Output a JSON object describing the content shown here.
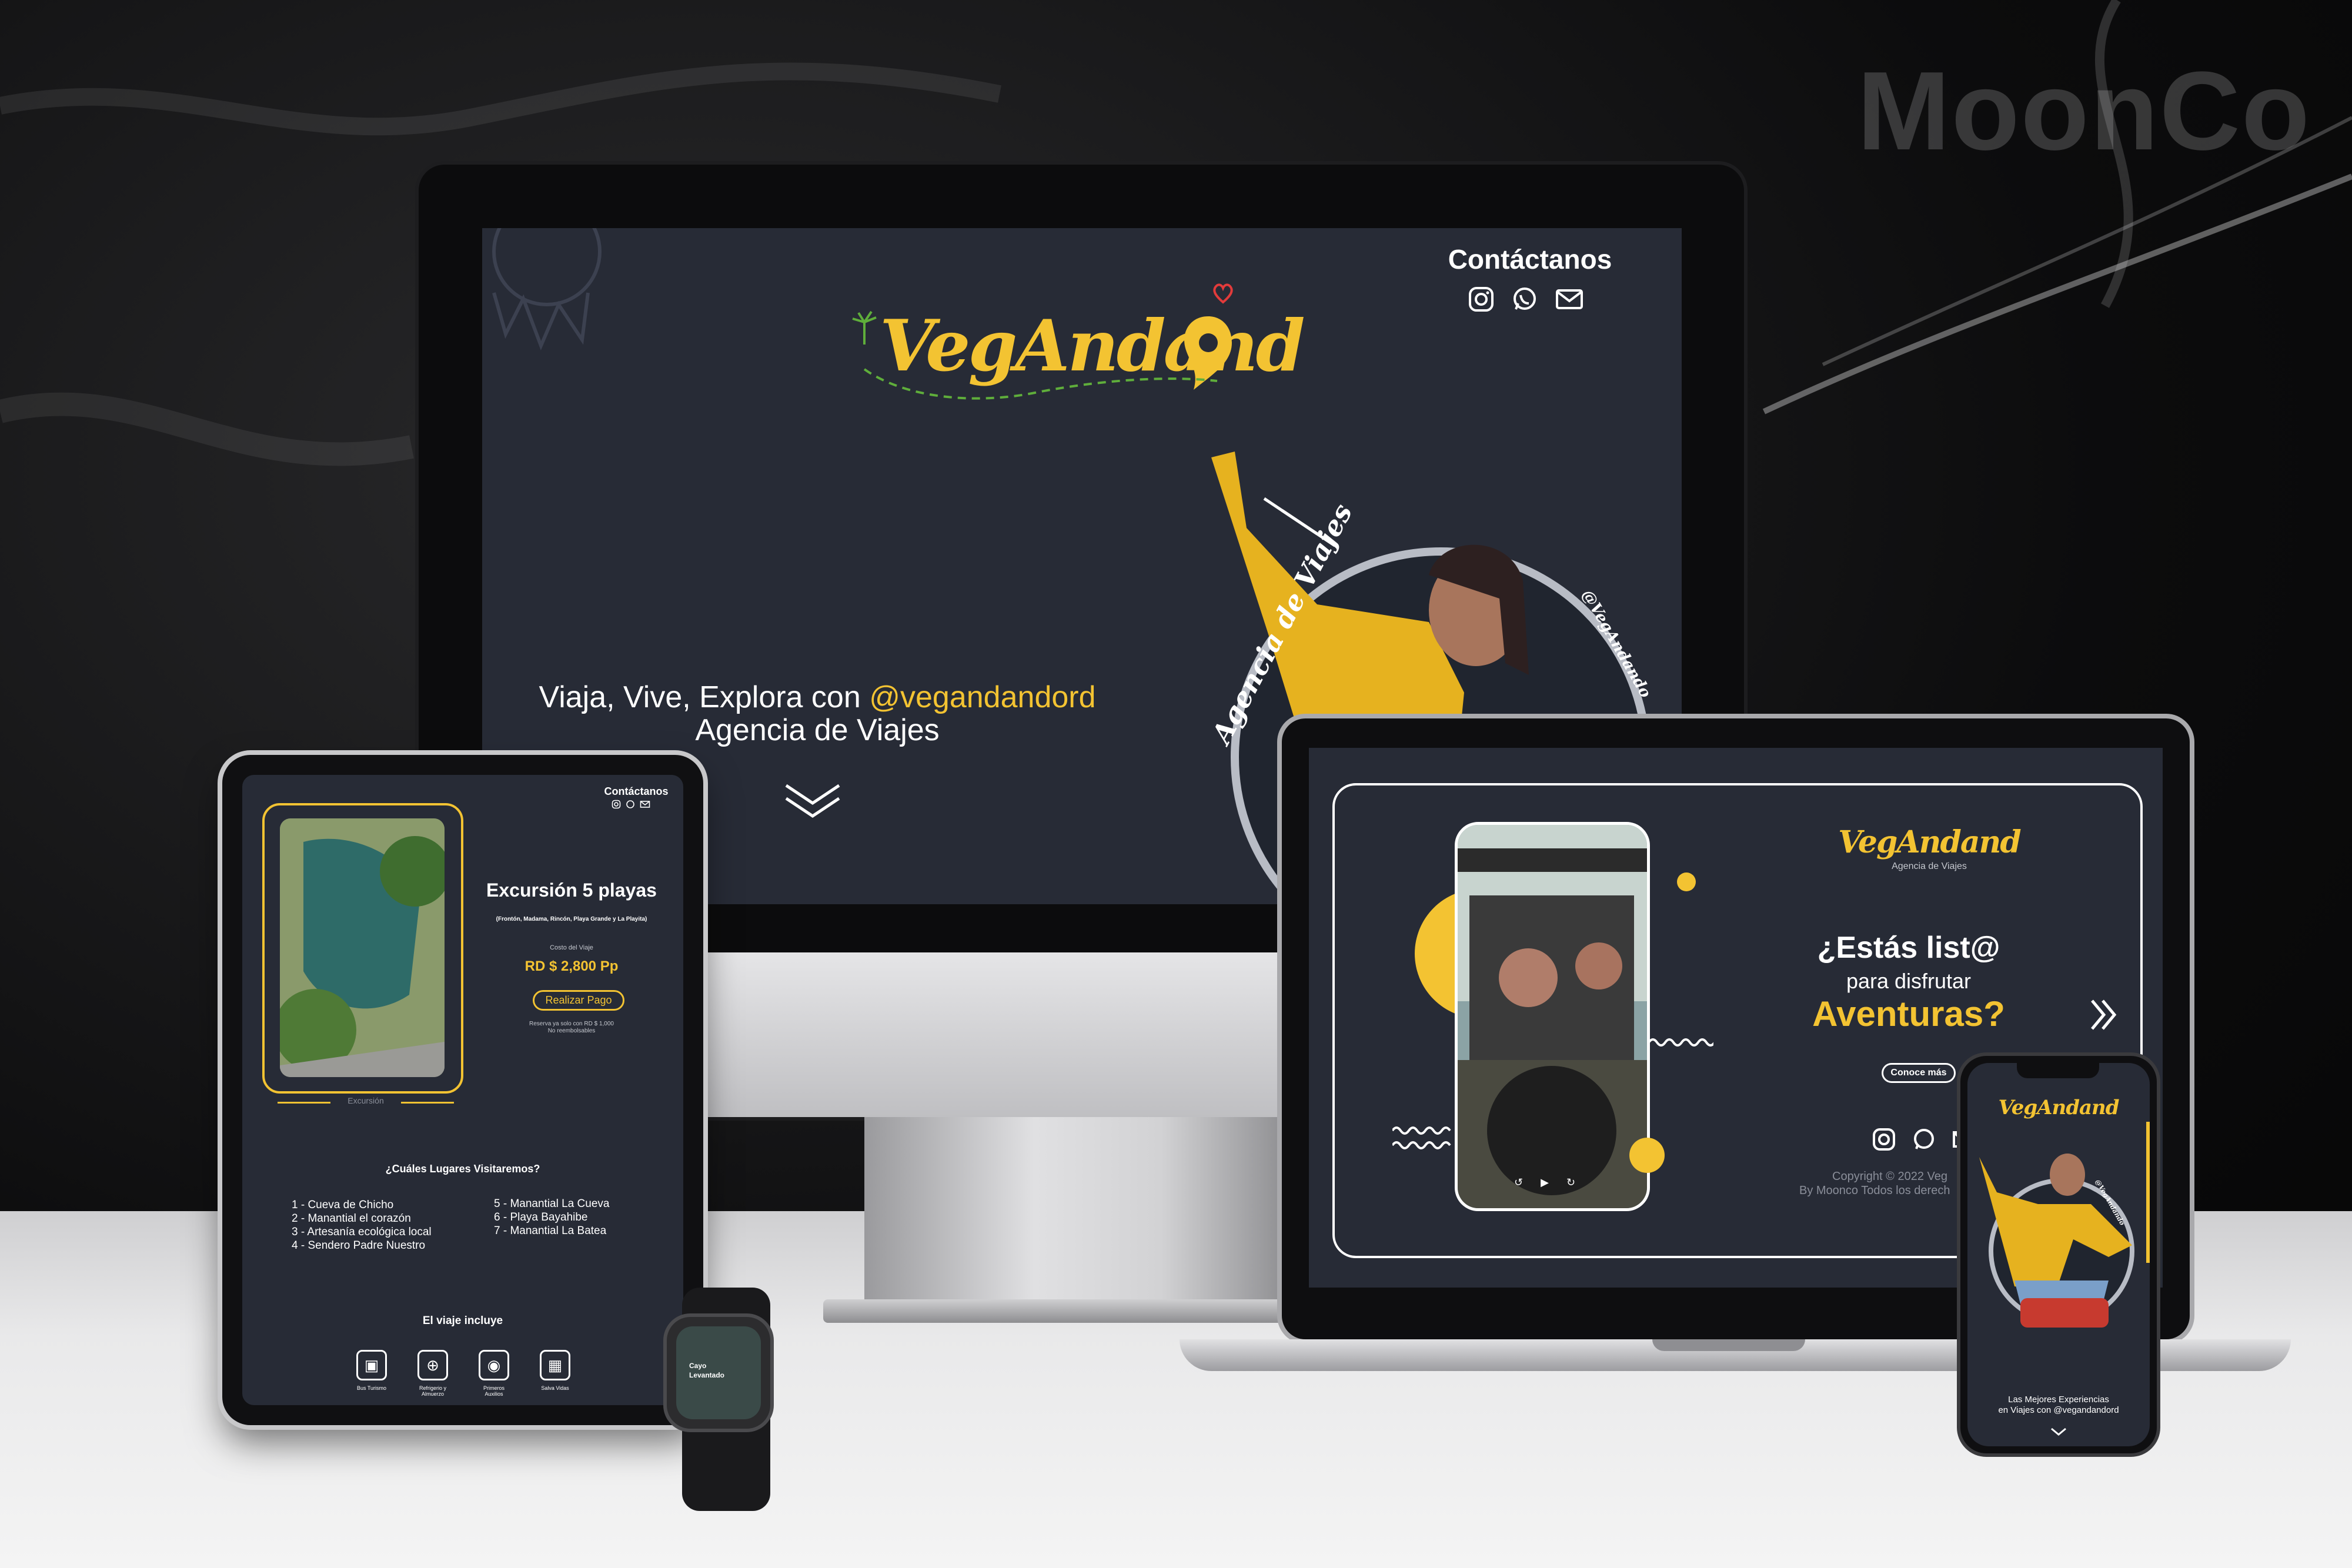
{
  "watermark": "MoonCo",
  "colors": {
    "accent": "#f3c332",
    "screen_bg": "#272b36",
    "text": "#ffffff"
  },
  "desktop": {
    "contact_title": "Contáctanos",
    "contact_icons": [
      "instagram-icon",
      "whatsapp-icon",
      "mail-icon"
    ],
    "logo_text": "VegAndand",
    "tagline_prefix": "Viaja, Vive, Explora con ",
    "tagline_handle": "@vegandandord",
    "tagline_line2": "Agencia de Viajes",
    "badge_text": "Agencia de Viajes",
    "badge_handle": "@VegAndando",
    "scroll_icon": "double-chevron-down-icon"
  },
  "tablet": {
    "contact_title": "Contáctanos",
    "image_caption": "Excursión",
    "tour_title": "Excursión 5 playas",
    "tour_subtitle": "(Frontón, Madama, Rincón, Playa Grande y La Playita)",
    "price_label": "Costo del Viaje",
    "price": "RD $ 2,800 Pp",
    "pay_button": "Realizar Pago",
    "reserve_note_1": "Reserva ya solo con RD $ 1,000",
    "reserve_note_2": "No reembolsables",
    "places_title": "¿Cuáles Lugares Visitaremos?",
    "places_left": [
      "1 - Cueva de Chicho",
      "2 - Manantial el corazón",
      "3 - Artesanía ecológica local",
      "4 - Sendero Padre Nuestro"
    ],
    "places_right": [
      "5 - Manantial La Cueva",
      "6 - Playa Bayahibe",
      "7 - Manantial La Batea"
    ],
    "includes_title": "El viaje incluye",
    "includes": [
      {
        "icon": "bus-icon",
        "label": "Bus Turismo"
      },
      {
        "icon": "food-icon",
        "label": "Refrigerio y Almuerzo"
      },
      {
        "icon": "first-aid-icon",
        "label": "Primeros Auxilios"
      },
      {
        "icon": "life-vest-icon",
        "label": "Salva Vidas"
      }
    ]
  },
  "watch": {
    "line1": "Cayo",
    "line2": "Levantado"
  },
  "laptop": {
    "logo_text": "VegAndand",
    "logo_sub": "Agencia de Viajes",
    "q_line1": "¿Estás list@",
    "q_line2": "para disfrutar",
    "q_line3": "Aventuras?",
    "cta": "Conoce más",
    "next_icon": "double-chevron-right-icon",
    "footer_icons": [
      "instagram-icon",
      "whatsapp-icon",
      "mail-icon"
    ],
    "copyright_1": "Copyright ©  2022 Veg",
    "copyright_2": "By Moonco Todos los derech"
  },
  "phone": {
    "logo_text": "VegAndand",
    "badge_handle": "@VegAndando",
    "caption_1": "Las Mejores Experiencias",
    "caption_2": "en Viajes con @vegandandord",
    "scroll_icon": "chevron-down-icon"
  }
}
